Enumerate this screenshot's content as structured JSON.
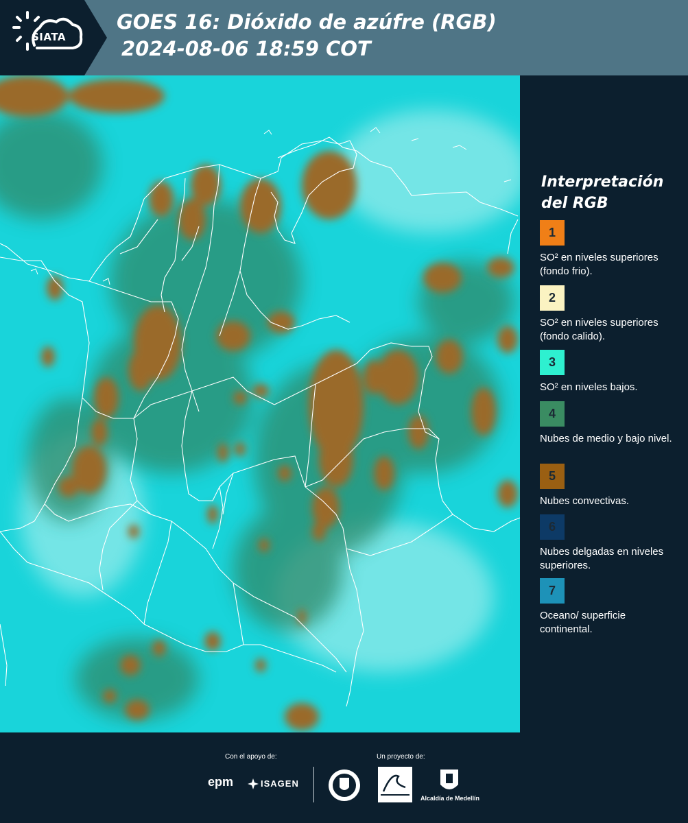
{
  "header": {
    "logo_text": "SIATA",
    "title_line1": "GOES 16: Dióxido de azúfre (RGB)",
    "title_line2": "2024-08-06 18:59 COT"
  },
  "legend": {
    "title": "Interpretación del RGB",
    "items": [
      {
        "number": "1",
        "color": "#f07f17",
        "text": "SO² en niveles superiores (fondo frio)."
      },
      {
        "number": "2",
        "color": "#fbf3c2",
        "text": "SO² en niveles superiores (fondo calido)."
      },
      {
        "number": "3",
        "color": "#2ef0d0",
        "text": "SO² en niveles bajos."
      },
      {
        "number": "4",
        "color": "#3a8c62",
        "text": "Nubes de medio y bajo nivel."
      },
      {
        "number": "5",
        "color": "#9a5f12",
        "text": "Nubes convectivas."
      },
      {
        "number": "6",
        "color": "#0d3a66",
        "text": "Nubes delgadas en niveles superiores."
      },
      {
        "number": "7",
        "color": "#1d92b8",
        "text": "Oceano/ superficie continental."
      }
    ]
  },
  "footer": {
    "support_label": "Con el apoyo de:",
    "project_label": "Un proyecto de:",
    "sponsors": [
      "epm",
      "ISAGEN"
    ],
    "partners": [
      "Área Metropolitana Valle de Aburrá",
      "Alcaldía de Medellín"
    ],
    "alcaldia_text": "Alcaldía de Medellín"
  },
  "map": {
    "background_color": "#19d4da",
    "cloud_color": "#9a6a2c"
  }
}
